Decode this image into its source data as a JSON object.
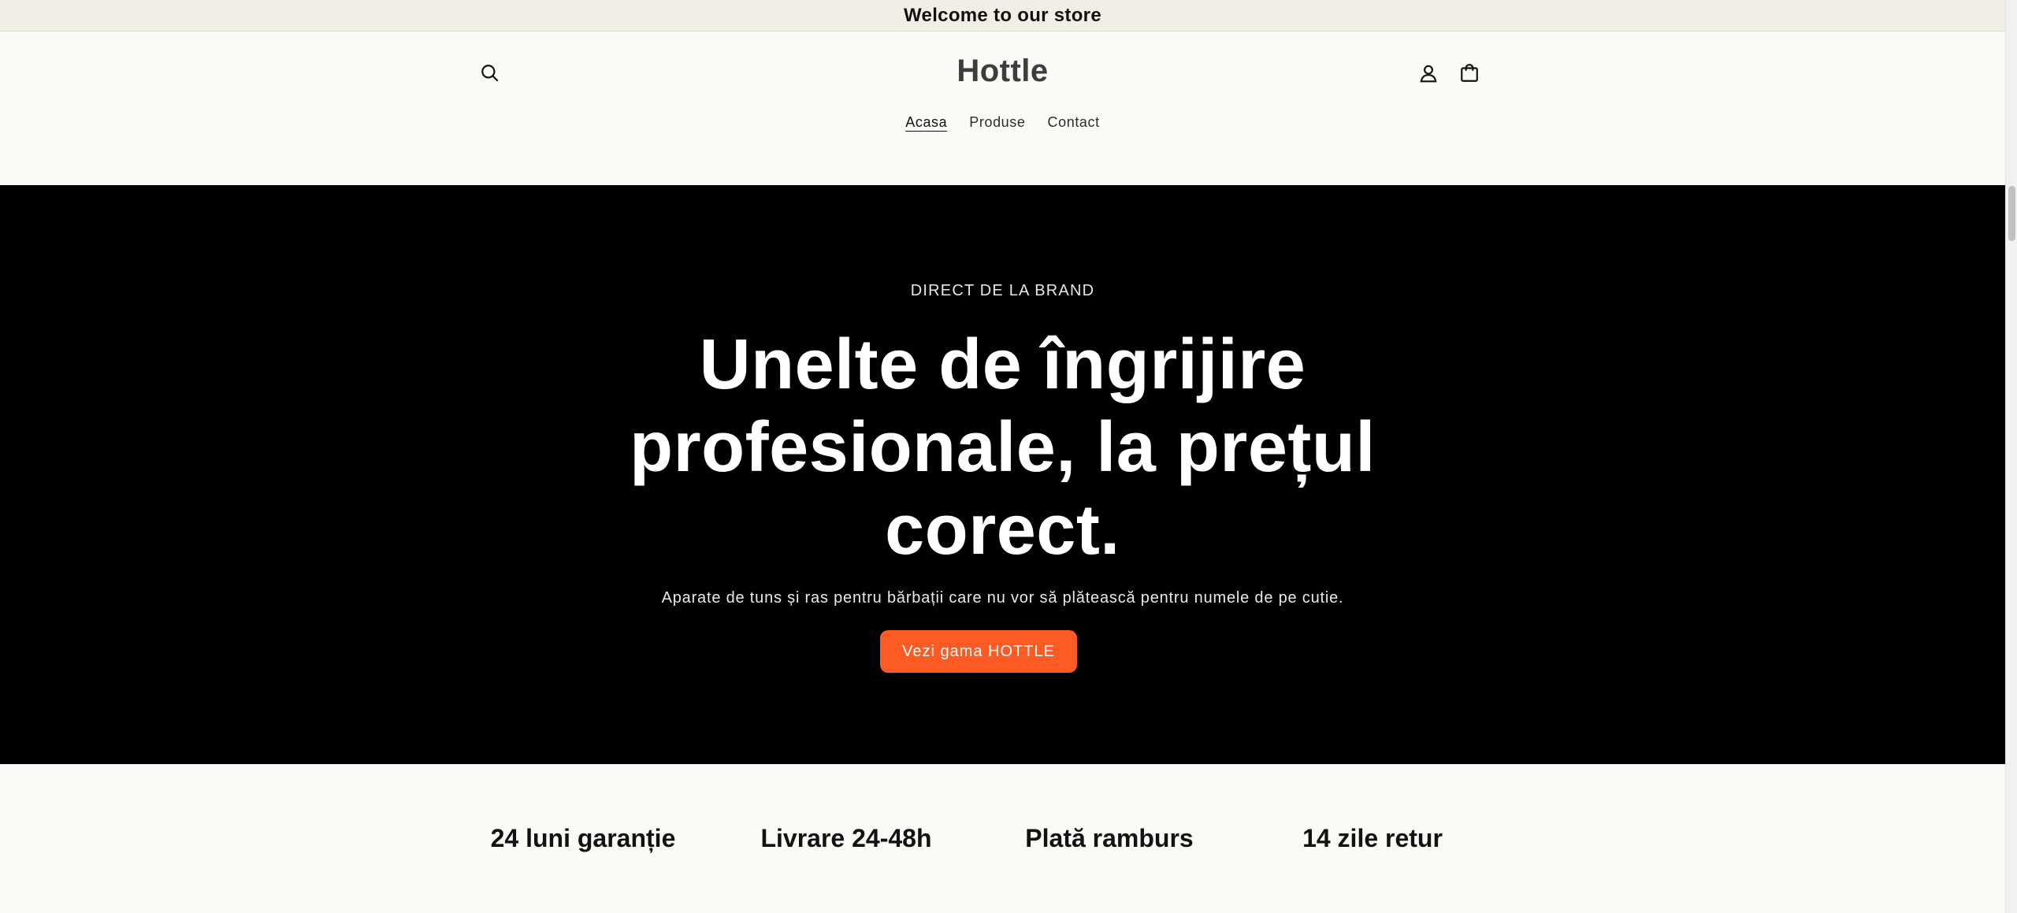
{
  "announcement": {
    "text": "Welcome to our store"
  },
  "header": {
    "logo": "Hottle",
    "icons": {
      "search": "search-icon",
      "account": "account-icon",
      "cart": "cart-icon"
    },
    "nav": [
      {
        "label": "Acasa",
        "active": true
      },
      {
        "label": "Produse",
        "active": false
      },
      {
        "label": "Contact",
        "active": false
      }
    ]
  },
  "hero": {
    "eyebrow": "DIRECT DE LA BRAND",
    "title": "Unelte de îngrijire profesionale, la prețul corect.",
    "subtitle": "Aparate de tuns și ras pentru bărbații care nu vor să plătească pentru numele de pe cutie.",
    "cta": "Vezi gama HOTTLE",
    "background_color": "#000000",
    "cta_color": "#fe5a23"
  },
  "features": [
    {
      "label": "24 luni garanție"
    },
    {
      "label": "Livrare 24-48h"
    },
    {
      "label": "Plată ramburs"
    },
    {
      "label": "14 zile retur"
    }
  ]
}
